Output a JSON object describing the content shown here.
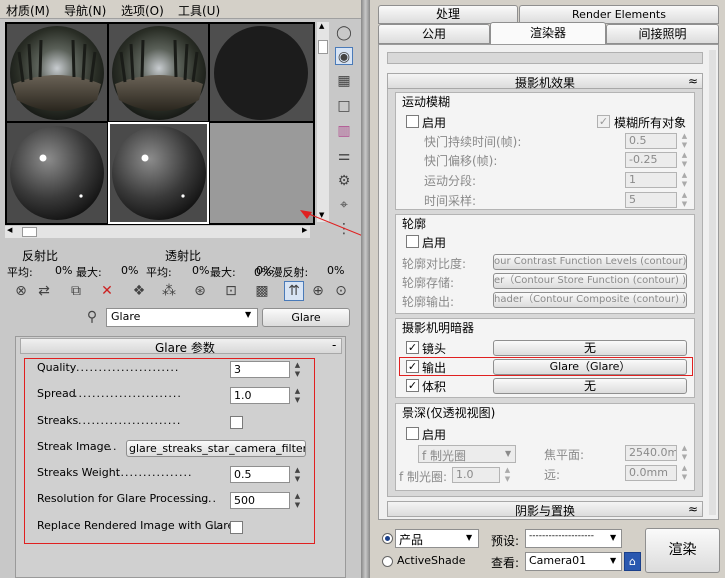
{
  "menu": [
    "材质(M)",
    "导航(N)",
    "选项(O)",
    "工具(U)"
  ],
  "samples": [
    {
      "kind": "forest"
    },
    {
      "kind": "forest"
    },
    {
      "kind": "dark"
    },
    {
      "kind": "sphere"
    },
    {
      "kind": "sphere"
    },
    {
      "kind": "flat"
    }
  ],
  "stats": {
    "reflect_title": "反射比",
    "transmit_title": "透射比",
    "reflect_avg": "平均:",
    "reflect_avg_val": "0%",
    "reflect_max": "最大:",
    "reflect_max_val": "0%",
    "transmit_avg": "平均:",
    "transmit_avg_val": "0%",
    "transmit_max": "最大:",
    "transmit_max_val": "0%",
    "diffuse": "0%漫反射:",
    "diffuse_val": "0%"
  },
  "material": {
    "name": "Glare",
    "type_button": "Glare"
  },
  "glare_panel": {
    "title": "Glare 参数",
    "collapse": "-",
    "quality_label": "Quality",
    "quality_value": "3",
    "spread_label": "Spread",
    "spread_value": "1.0",
    "streaks_label": "Streaks",
    "streak_image_label": "Streak Image",
    "streak_image_value": "glare_streaks_star_camera_filter.tif",
    "streaks_weight_label": "Streaks Weight",
    "streaks_weight_value": "0.5",
    "resolution_label": "Resolution for Glare Processing",
    "resolution_value": "500",
    "replace_label": "Replace Rendered Image with Glare"
  },
  "tabs_top": [
    "处理",
    "Render Elements"
  ],
  "tabs_bottom": [
    "公用",
    "渲染器",
    "间接照明"
  ],
  "rollout": {
    "title": "摄影机效果",
    "collapse": "≈"
  },
  "motion_blur": {
    "title": "运动模糊",
    "enable": "启用",
    "all_objects": "模糊所有对象",
    "shutter_label": "快门持续时间(帧):",
    "shutter_value": "0.5",
    "offset_label": "快门偏移(帧):",
    "offset_value": "-0.25",
    "segments_label": "运动分段:",
    "segments_value": "1",
    "samples_label": "时间采样:",
    "samples_value": "5"
  },
  "contour": {
    "title": "轮廓",
    "enable": "启用",
    "contrast_label": "轮廓对比度:",
    "contrast_value": "our Contrast Function Levels (contour) )",
    "store_label": "轮廓存储:",
    "store_value": "er（Contour Store Function (contour) )",
    "output_label": "轮廓输出:",
    "output_value": "hader（Contour Composite (contour) )"
  },
  "shaders": {
    "title": "摄影机明暗器",
    "lens": "镜头",
    "lens_value": "无",
    "output": "输出",
    "output_value": "Glare（Glare）",
    "volume": "体积",
    "volume_value": "无"
  },
  "dof": {
    "title": "景深(仅透视视图)",
    "enable": "启用",
    "fstop_mode": "f 制光圈",
    "focal_label": "焦平面:",
    "focal_value": "2540.0mm",
    "fstop_label": "f 制光圈:",
    "fstop_value": "1.0",
    "far_label": "远:",
    "far_value": "0.0mm"
  },
  "shadows_rollout": {
    "title": "阴影与置换",
    "collapse": "≈"
  },
  "bottom": {
    "mode_product": "产品",
    "mode_activeshade": "ActiveShade",
    "preset_label": "预设:",
    "preset_value": "--------------------",
    "view_label": "查看:",
    "view_value": "Camera01",
    "render_button": "渲染"
  },
  "colors": {
    "highlight": "#e02020",
    "accent": "#1a3f8a"
  }
}
